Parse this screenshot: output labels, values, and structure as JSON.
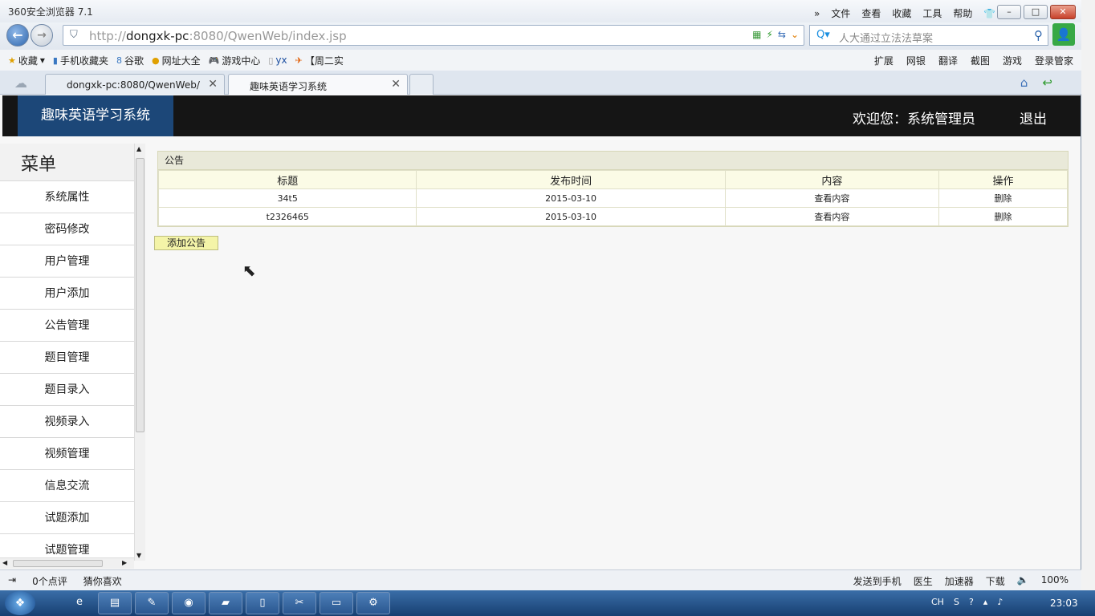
{
  "browser": {
    "title": "360安全浏览器 7.1",
    "menu": [
      "文件",
      "查看",
      "收藏",
      "工具",
      "帮助"
    ],
    "url_host": "http://",
    "url_main": "dongxk-pc",
    "url_rest": ":8080/QwenWeb/index.jsp",
    "search_placeholder": "人大通过立法法草案",
    "bookmarks": [
      "收藏",
      "手机收藏夹",
      "谷歌",
      "网址大全",
      "游戏中心",
      "yx",
      "【周二实"
    ],
    "bookmarks_right": [
      "扩展",
      "网银",
      "翻译",
      "截图",
      "游戏",
      "登录管家"
    ],
    "tabs": [
      {
        "label": "dongxk-pc:8080/QwenWeb/"
      },
      {
        "label": "趣味英语学习系统"
      }
    ]
  },
  "app": {
    "logo": "趣味英语学习系统",
    "welcome": "欢迎您：系统管理员",
    "logout": "退出",
    "menu_title": "菜单",
    "menu_items": [
      "系统属性",
      "密码修改",
      "用户管理",
      "用户添加",
      "公告管理",
      "题目管理",
      "题目录入",
      "视频录入",
      "视频管理",
      "信息交流",
      "试题添加",
      "试题管理"
    ]
  },
  "notice": {
    "panel_title": "公告",
    "columns": [
      "标题",
      "发布时间",
      "内容",
      "操作"
    ],
    "rows": [
      {
        "title": "34t5",
        "date": "2015-03-10",
        "content": "查看内容",
        "action": "删除"
      },
      {
        "title": "t2326465",
        "date": "2015-03-10",
        "content": "查看内容",
        "action": "删除"
      }
    ],
    "add_button": "添加公告"
  },
  "status": {
    "left": [
      "0个点评",
      "猜你喜欢"
    ],
    "right": [
      "发送到手机",
      "医生",
      "加速器",
      "下载"
    ],
    "zoom": "100%"
  },
  "taskbar": {
    "lang": "CH",
    "time": "23:03"
  }
}
